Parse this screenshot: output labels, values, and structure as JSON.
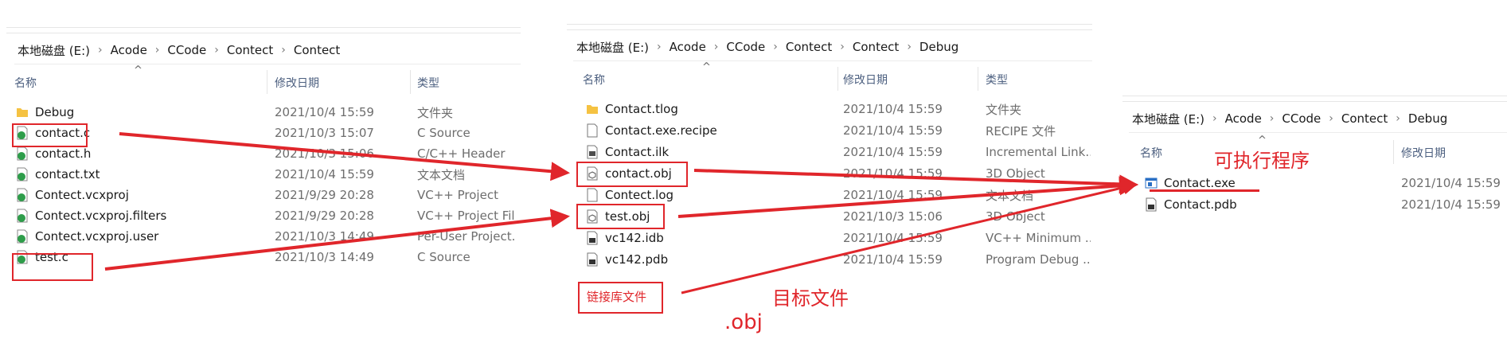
{
  "colors": {
    "accent_red": "#e0262b",
    "header_text": "#4d6080",
    "meta_text": "#6d6d6d"
  },
  "panel1": {
    "breadcrumb": [
      "本地磁盘 (E:)",
      "Acode",
      "CCode",
      "Contect",
      "Contect"
    ],
    "headers": {
      "name": "名称",
      "date": "修改日期",
      "type": "类型"
    },
    "rows": [
      {
        "name": "Debug",
        "date": "2021/10/4 15:59",
        "type": "文件夹",
        "icon": "folder-icon"
      },
      {
        "name": "contact.c",
        "date": "2021/10/3 15:07",
        "type": "C Source",
        "icon": "c-source-icon"
      },
      {
        "name": "contact.h",
        "date": "2021/10/3 15:06",
        "type": "C/C++ Header",
        "icon": "header-file-icon"
      },
      {
        "name": "contact.txt",
        "date": "2021/10/4 15:59",
        "type": "文本文档",
        "icon": "text-file-icon"
      },
      {
        "name": "Contect.vcxproj",
        "date": "2021/9/29 20:28",
        "type": "VC++ Project",
        "icon": "vcxproj-icon"
      },
      {
        "name": "Contect.vcxproj.filters",
        "date": "2021/9/29 20:28",
        "type": "VC++ Project Fil",
        "icon": "vcxproj-icon"
      },
      {
        "name": "Contect.vcxproj.user",
        "date": "2021/10/3 14:49",
        "type": "Per-User Project...",
        "icon": "vcxproj-icon"
      },
      {
        "name": "test.c",
        "date": "2021/10/3 14:49",
        "type": "C Source",
        "icon": "c-source-icon"
      }
    ]
  },
  "panel2": {
    "breadcrumb": [
      "本地磁盘 (E:)",
      "Acode",
      "CCode",
      "Contect",
      "Contect",
      "Debug"
    ],
    "headers": {
      "name": "名称",
      "date": "修改日期",
      "type": "类型"
    },
    "rows": [
      {
        "name": "Contact.tlog",
        "date": "2021/10/4 15:59",
        "type": "文件夹",
        "icon": "folder-icon"
      },
      {
        "name": "Contact.exe.recipe",
        "date": "2021/10/4 15:59",
        "type": "RECIPE 文件",
        "icon": "file-icon"
      },
      {
        "name": "Contact.ilk",
        "date": "2021/10/4 15:59",
        "type": "Incremental Link...",
        "icon": "ilk-file-icon"
      },
      {
        "name": "contact.obj",
        "date": "2021/10/4 15:59",
        "type": "3D Object",
        "icon": "obj-file-icon"
      },
      {
        "name": "Contect.log",
        "date": "2021/10/4 15:59",
        "type": "文本文档",
        "icon": "file-icon"
      },
      {
        "name": "test.obj",
        "date": "2021/10/3 15:06",
        "type": "3D Object",
        "icon": "obj-file-icon"
      },
      {
        "name": "vc142.idb",
        "date": "2021/10/4 15:59",
        "type": "VC++ Minimum ...",
        "icon": "idb-file-icon"
      },
      {
        "name": "vc142.pdb",
        "date": "2021/10/4 15:59",
        "type": "Program Debug ...",
        "icon": "pdb-file-icon"
      }
    ]
  },
  "panel3": {
    "breadcrumb": [
      "本地磁盘 (E:)",
      "Acode",
      "CCode",
      "Contect",
      "Debug"
    ],
    "headers": {
      "name": "名称",
      "date": "修改日期"
    },
    "rows": [
      {
        "name": "Contact.exe",
        "date": "2021/10/4 15:59",
        "icon": "exe-file-icon"
      },
      {
        "name": "Contact.pdb",
        "date": "2021/10/4 15:59",
        "icon": "pdb-file-icon"
      }
    ]
  },
  "annotations": {
    "link_label": "链接库文件",
    "object_files": "目标文件",
    "obj_ext": ".obj",
    "executable": "可执行程序"
  }
}
